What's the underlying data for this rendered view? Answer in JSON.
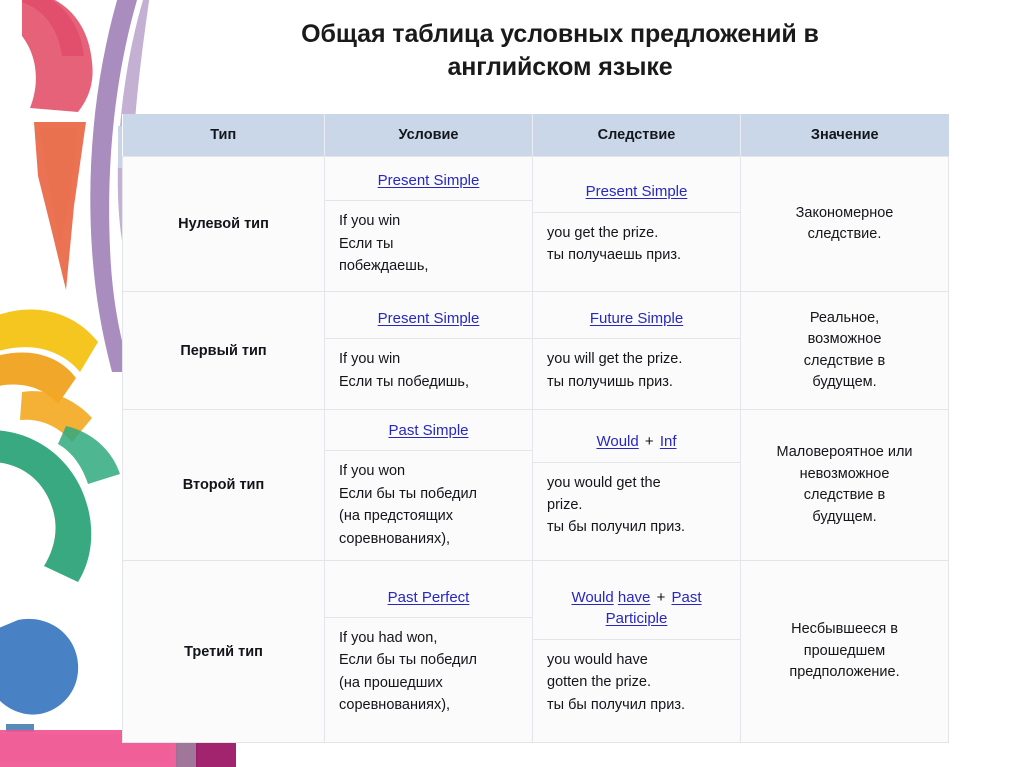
{
  "page": {
    "title_line1": "Общая таблица условных предложений в",
    "title_line2": "английском языке"
  },
  "table": {
    "headers": {
      "type": "Тип",
      "condition": "Условие",
      "consequence": "Следствие",
      "meaning": "Значение"
    },
    "rows": [
      {
        "type": "Нулевой тип",
        "condition_tense": "Present Simple",
        "condition_tense_parts": [
          {
            "text": "Present Simple",
            "link": true
          }
        ],
        "condition_en": "If you win",
        "condition_ru_1": "Если ты",
        "condition_ru_2": "побеждаешь,",
        "consequence_tense_parts": [
          {
            "text": "Present Simple",
            "link": true
          }
        ],
        "consequence_en": "you get the prize.",
        "consequence_ru": "ты получаешь приз.",
        "meaning_1": "Закономерное",
        "meaning_2": "следствие."
      },
      {
        "type": "Первый тип",
        "condition_tense_parts": [
          {
            "text": "Present Simple",
            "link": true
          }
        ],
        "condition_en": "If you win",
        "condition_ru_1": "Если ты победишь,",
        "condition_ru_2": "",
        "consequence_tense_parts": [
          {
            "text": "Future Simple",
            "link": true
          }
        ],
        "consequence_en": "you will get the prize.",
        "consequence_ru": "ты получишь приз.",
        "meaning_1": "Реальное,",
        "meaning_2": "возможное",
        "meaning_3": "следствие в",
        "meaning_4": "будущем."
      },
      {
        "type": "Второй тип",
        "condition_tense_parts": [
          {
            "text": "Past Simple",
            "link": true
          }
        ],
        "condition_en": "If you won",
        "condition_ru_1": "Если бы ты победил",
        "condition_ru_2": "(на предстоящих",
        "condition_ru_3": "соревнованиях),",
        "consequence_tense_parts": [
          {
            "text": "Would",
            "link": true
          },
          {
            "text": " + ",
            "link": false
          },
          {
            "text": "Inf",
            "link": true
          }
        ],
        "consequence_en_1": "you would get the",
        "consequence_en_2": "prize.",
        "consequence_ru": "ты бы получил приз.",
        "meaning_1": "Маловероятное или",
        "meaning_2": "невозможное",
        "meaning_3": "следствие в",
        "meaning_4": "будущем."
      },
      {
        "type": "Третий тип",
        "condition_tense_parts": [
          {
            "text": "Past Perfect",
            "link": true
          }
        ],
        "condition_en": "If you had won,",
        "condition_ru_1": "Если бы ты победил",
        "condition_ru_2": "(на прошедших",
        "condition_ru_3": "соревнованиях),",
        "consequence_tense_parts": [
          {
            "text": "Would",
            "link": true
          },
          {
            "text": " ",
            "link": false
          },
          {
            "text": "have",
            "link": true
          },
          {
            "text": " + ",
            "link": false
          },
          {
            "text": "Past",
            "link": true
          },
          {
            "text": " ",
            "link": false
          },
          {
            "text": "Participle",
            "link": true
          }
        ],
        "consequence_en_1": "you would have",
        "consequence_en_2": "gotten the prize.",
        "consequence_ru": "ты бы получил приз.",
        "meaning_1": "Несбывшееся в",
        "meaning_2": "прошедшем",
        "meaning_3": "предположение."
      }
    ]
  },
  "colors": {
    "header_bg": "#c9d7e8",
    "link": "#2727c4",
    "text": "#141619",
    "border": "#e2e5ea"
  }
}
